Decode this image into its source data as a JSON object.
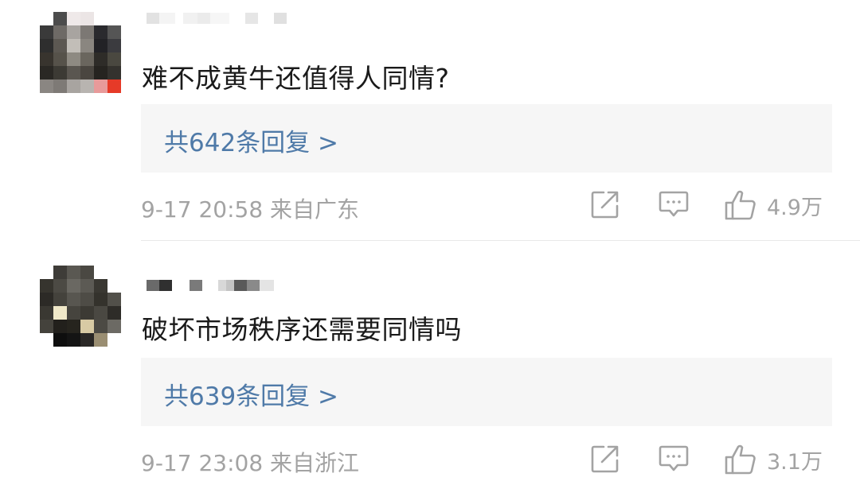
{
  "comments": [
    {
      "text": "难不成黄牛还值得人同情?",
      "reply_link": "共642条回复 >",
      "time": "9-17 20:58",
      "location": "来自广东",
      "likes": "4.9万"
    },
    {
      "text": "破坏市场秩序还需要同情吗",
      "reply_link": "共639条回复 >",
      "time": "9-17 23:08",
      "location": "来自浙江",
      "likes": "3.1万"
    }
  ],
  "colors": {
    "link": "#4f7aa8",
    "meta": "#a3a3a3",
    "text": "#1a1a1a",
    "reply_box_bg": "#f6f6f6",
    "divider": "#e9e9e9"
  },
  "icons": {
    "share": "share-icon",
    "reply": "comment-icon",
    "like": "thumbs-up-icon"
  }
}
